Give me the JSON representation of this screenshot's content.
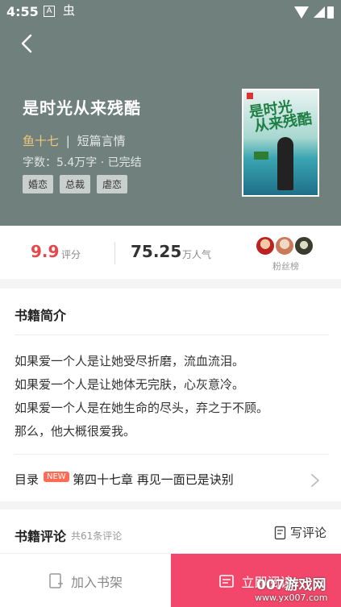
{
  "status_bar": {
    "time": "4:55",
    "a_icon": "A",
    "bug_icon": "虫"
  },
  "book": {
    "title": "是时光从来残酷",
    "author": "鱼十七",
    "separator": "|",
    "genre": "短篇言情",
    "word_count": "字数：5.4万字",
    "dot": "·",
    "status": "已完结",
    "tags": [
      "婚恋",
      "总裁",
      "虐恋"
    ],
    "cover_title": "是时光从来残酷"
  },
  "stats": {
    "rating": "9.9",
    "rating_label": "评分",
    "popularity": "75.25",
    "popularity_label": "万人气",
    "fans_label": "粉丝榜"
  },
  "intro": {
    "title": "书籍简介",
    "lines": [
      "如果爱一个人是让她受尽折磨，流血流泪。",
      "如果爱一个人是让她体无完肤，心灰意冷。",
      "如果爱一个人是在她生命的尽头，弃之于不顾。",
      "那么，他大概很爱我。"
    ]
  },
  "toc": {
    "label": "目录",
    "badge": "NEW",
    "latest_chapter": "第四十七章 再见一面已是诀别"
  },
  "reviews": {
    "title": "书籍评论",
    "count": "共61条评论",
    "write_label": "写评论"
  },
  "bottom": {
    "shelf_label": "加入书架",
    "read_label": "立即阅读",
    "watermark": "007游戏网",
    "watermark_url": "www.yx007.com"
  },
  "colors": {
    "hero_bg": "#6f807d",
    "accent": "#f2476a",
    "rating": "#e5484d",
    "author": "#f3c67a"
  }
}
